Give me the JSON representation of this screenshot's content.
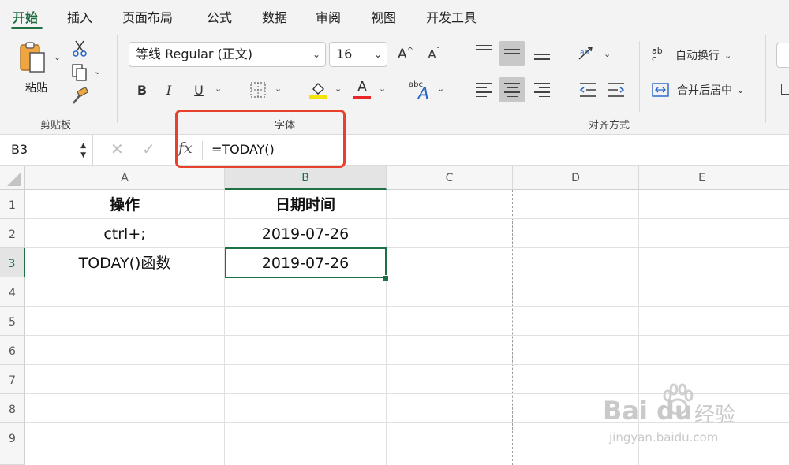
{
  "tabs": [
    "开始",
    "插入",
    "页面布局",
    "公式",
    "数据",
    "审阅",
    "视图",
    "开发工具"
  ],
  "clipboard": {
    "paste_label": "粘贴",
    "group_label": "剪贴板"
  },
  "font": {
    "name": "等线 Regular (正文)",
    "size": "16",
    "group_label": "字体",
    "bold": "B",
    "italic": "I",
    "underline": "U",
    "font_color_letter": "A",
    "grow_letter": "A",
    "shrink_letter": "A",
    "orient_label": "abc"
  },
  "alignment": {
    "wrap_label": "自动换行",
    "merge_label": "合并后居中",
    "group_label": "对齐方式",
    "wrap_icon_text": "ab c"
  },
  "formula_bar": {
    "name_box": "B3",
    "fx": "fx",
    "formula": "=TODAY()"
  },
  "columns": [
    "A",
    "B",
    "C",
    "D",
    "E"
  ],
  "rows": [
    "1",
    "2",
    "3",
    "4",
    "5",
    "6",
    "7",
    "8",
    "9"
  ],
  "cells": {
    "A1": "操作",
    "B1": "日期时间",
    "A2": "ctrl+;",
    "B2": "2019-07-26",
    "A3": "TODAY()函数",
    "B3": "2019-07-26"
  },
  "selected_cell": "B3",
  "watermark": {
    "brand": "Bai",
    "brand2": "du",
    "cn": "经验",
    "url": "jingyan.baidu.com"
  },
  "colors": {
    "accent": "#1e7145",
    "highlight": "#e8402b",
    "font_color": "#e8262a",
    "fill_color": "#f5e400"
  }
}
